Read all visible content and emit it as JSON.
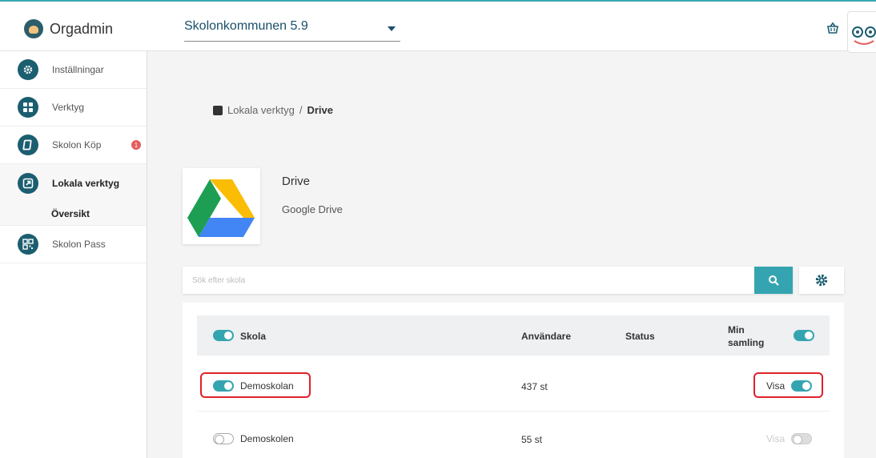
{
  "app": {
    "name": "Orgadmin"
  },
  "org_select": {
    "value": "Skolonkommunen 5.9"
  },
  "sidebar": {
    "items": [
      {
        "label": "Inställningar",
        "icon": "gear-icon"
      },
      {
        "label": "Verktyg",
        "icon": "grid-icon"
      },
      {
        "label": "Skolon Köp",
        "icon": "book-icon",
        "badge": "1"
      },
      {
        "label": "Lokala verktyg",
        "icon": "external-link-icon"
      },
      {
        "label": "Skolon Pass",
        "icon": "qr-code-icon"
      }
    ],
    "sub_item": "Översikt"
  },
  "breadcrumb": {
    "parent": "Lokala verktyg",
    "separator": "/",
    "current": "Drive"
  },
  "tool": {
    "title": "Drive",
    "subtitle": "Google Drive"
  },
  "search": {
    "placeholder": "Sök efter skola"
  },
  "table": {
    "headers": {
      "school": "Skola",
      "users": "Användare",
      "status": "Status",
      "collection": "Min samling"
    },
    "rows": [
      {
        "school": "Demoskolan",
        "users": "437 st",
        "visibility": "Visa",
        "active": true
      },
      {
        "school": "Demoskolen",
        "users": "55 st",
        "visibility": "Visa",
        "active": false
      }
    ]
  },
  "colors": {
    "accent": "#34a5b0",
    "sidebar_icon": "#1b5e70",
    "badge": "#e35d5d",
    "highlight": "#e0202a"
  }
}
